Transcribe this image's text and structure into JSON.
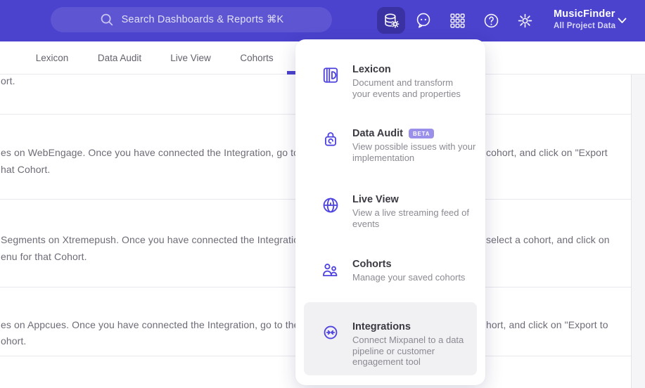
{
  "colors": {
    "brand": "#4b42cd",
    "brand-dark": "#3a31a3",
    "accent": "#4f44df",
    "badge": "#9a90ea",
    "hover": "#f1f0f2",
    "line": "#e9e8ec",
    "gutter": "#f5f4f6",
    "title": "#3b3a42",
    "desc": "#8b8a92",
    "body": "#6d6c76",
    "tab": "#63626c"
  },
  "header": {
    "search_placeholder": "Search Dashboards & Reports ⌘K",
    "project_name": "MusicFinder",
    "project_subtitle": "All Project Data"
  },
  "tabs": {
    "lexicon": "Lexicon",
    "data_audit": "Data Audit",
    "live_view": "Live View",
    "cohorts": "Cohorts"
  },
  "menu": {
    "items": [
      {
        "title": "Lexicon",
        "desc": "Document and transform\nyour events and properties"
      },
      {
        "title": "Data Audit",
        "badge": "BETA",
        "desc": "View possible issues with your\nimplementation"
      },
      {
        "title": "Live View",
        "desc": "View a live streaming feed of\nevents"
      },
      {
        "title": "Cohorts",
        "desc": "Manage your saved cohorts"
      },
      {
        "title": "Integrations",
        "desc": "Connect Mixpanel to a data\npipeline or customer\nengagement tool"
      }
    ]
  },
  "background": {
    "rows": [
      {
        "left1": "ort."
      },
      {
        "left1": "es on WebEngage. Once you have connected the Integration, go to the",
        "left2": "hat Cohort.",
        "right1": "cohort, and click on \"Export"
      },
      {
        "left1": "Segments on Xtremepush. Once you have connected the Integration, ",
        "left2": "enu for that Cohort.",
        "right1": "select a cohort, and click on"
      },
      {
        "left1": "es on Appcues. Once you have connected the Integration, go to the M",
        "left2": "ohort.",
        "right1": "hort, and click on \"Export to"
      }
    ]
  }
}
